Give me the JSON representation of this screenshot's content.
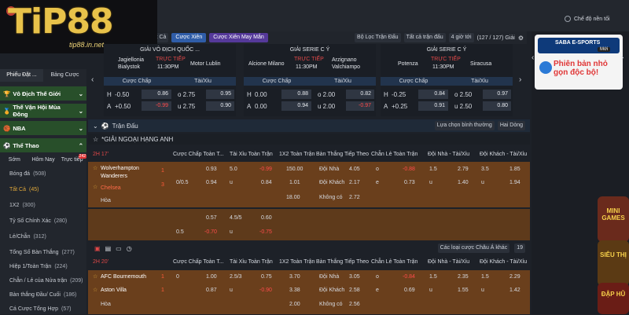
{
  "brand": {
    "logo": "TiP88",
    "url": "tip88.in.net"
  },
  "top": {
    "dark_mode_label": "Chế độ nền tối"
  },
  "toolbar": {
    "prefix": "ay",
    "sort": "Tất Cả",
    "tab_xien": "Cược Xiên",
    "tab_may_man": "Cược Xiên May Mắn",
    "filter_league": "Bộ Lọc Trận Đấu",
    "filter_all": "Tất cả trận đấu",
    "time": "4 giờ tới",
    "count": "(127 / 127) Giải"
  },
  "cards": [
    {
      "league": "GIẢI VÔ ĐỊCH QUỐC ...",
      "home": "Jagiellonia Bialystok",
      "status": "TRỰC TIẾP",
      "time": "11:30PM",
      "away": "Motor Lublin",
      "h_hcap": "-0.50",
      "h_odds": "0.86",
      "h_ou": "o 2.75",
      "h_ou_odds": "0.95",
      "a_hcap": "+0.50",
      "a_odds": "-0.99",
      "a_ou": "u 2.75",
      "a_ou_odds": "0.90"
    },
    {
      "league": "GIẢI SERIE C Ý",
      "home": "Alcione Milano",
      "status": "TRỰC TIẾP",
      "time": "11:30PM",
      "away": "Arzignano Valchiampo",
      "h_hcap": "0.00",
      "h_odds": "0.88",
      "h_ou": "o 2.00",
      "h_ou_odds": "0.82",
      "a_hcap": "0.00",
      "a_odds": "0.94",
      "a_ou": "u 2.00",
      "a_ou_odds": "-0.97"
    },
    {
      "league": "GIẢI SERIE C Ý",
      "home": "Potenza",
      "status": "TRỰC TIẾP",
      "time": "11:30PM",
      "away": "Siracusa",
      "h_hcap": "-0.25",
      "h_odds": "0.84",
      "h_ou": "o 2.50",
      "h_ou_odds": "0.97",
      "a_hcap": "+0.25",
      "a_odds": "0.91",
      "a_ou": "u 2.50",
      "a_ou_odds": "0.80"
    }
  ],
  "card_labels": {
    "hcap": "Cược Chấp",
    "ou": "Tài/Xỉu",
    "h": "H",
    "a": "A"
  },
  "sidebar": {
    "tabs": [
      "Phiếu Đặt ...",
      "Bảng Cược"
    ],
    "cats": [
      "Vô Địch Thế Giới",
      "Thế Vận Hội Mùa Đông",
      "NBA",
      "Thể Thao"
    ],
    "sub_tabs": [
      "Sớm",
      "Hôm Nay",
      "Trực tiếp"
    ],
    "live_badge": "242",
    "items": [
      {
        "label": "Bóng đá",
        "count": "(508)"
      },
      {
        "label": "Tất Cả",
        "count": "(45)"
      },
      {
        "label": "1X2",
        "count": "(300)"
      },
      {
        "label": "Tỷ Số Chính Xác",
        "count": "(280)"
      },
      {
        "label": "Lẻ/Chẵn",
        "count": "(312)"
      },
      {
        "label": "Tổng Số Bàn Thắng",
        "count": "(277)"
      },
      {
        "label": "Hiệp 1/Toàn Trận",
        "count": "(224)"
      },
      {
        "label": "Chẵn / Lẻ của Nửa trận",
        "count": "(209)"
      },
      {
        "label": "Bàn thắng Đầu/ Cuối",
        "count": "(186)"
      },
      {
        "label": "Cá Cược Tổng Hợp",
        "count": "(57)"
      }
    ]
  },
  "section": {
    "title": "Trận Đấu",
    "select_label": "Lựa chọn bình thường",
    "select_order": "Hai Dòng",
    "league": "*GIẢI NGOẠI HẠNG ANH",
    "asia_label": "Các loại cược Châu Á khác",
    "page_num": "19"
  },
  "cols": [
    "Cược Chấp Toàn T...",
    "Tài Xỉu Toàn Trận",
    "1X2 Toàn Trận",
    "Bàn Thắng Tiếp Theo",
    "Chẵn Lẻ Toàn Trận",
    "Đội Nhà - Tài/Xỉu",
    "Đội Khách - Tài/Xỉu"
  ],
  "match1": {
    "period": "2H 17'",
    "home": "Wolverhampton Wanderers",
    "away": "Chelsea",
    "draw": "Hòa",
    "home_score": "1",
    "away_score": "3",
    "r1": [
      "",
      "0.93",
      "5.0",
      "-0.99",
      "150.00",
      "Đội Nhà",
      "4.05",
      "o",
      "-0.88",
      "1.5",
      "2.79",
      "3.5",
      "1.85"
    ],
    "r2": [
      "0/0.5",
      "0.94",
      "u",
      "0.84",
      "1.01",
      "Đội Khách",
      "2.17",
      "e",
      "0.73",
      "u",
      "1.40",
      "u",
      "1.94"
    ],
    "r3": [
      "",
      "",
      "",
      "",
      "18.00",
      "Không có",
      "2.72"
    ],
    "r4": [
      "",
      "0.57",
      "4.5/5",
      "0.60"
    ],
    "r5": [
      "0.5",
      "-0.70",
      "u",
      "-0.75"
    ]
  },
  "match2": {
    "period": "2H 20'",
    "home": "AFC Bournemouth",
    "away": "Aston Villa",
    "draw": "Hòa",
    "home_score": "1",
    "away_score": "1",
    "r1": [
      "0",
      "1.00",
      "2.5/3",
      "0.75",
      "3.70",
      "Đội Nhà",
      "3.05",
      "o",
      "-0.84",
      "1.5",
      "2.35",
      "1.5",
      "2.29"
    ],
    "r2": [
      "",
      "0.87",
      "u",
      "-0.90",
      "3.38",
      "Đội Khách",
      "2.58",
      "e",
      "0.69",
      "u",
      "1.55",
      "u",
      "1.42"
    ],
    "r3": [
      "",
      "",
      "",
      "",
      "2.00",
      "Không có",
      "2.56"
    ]
  },
  "side": {
    "banner_title": "SABA E-SPORTS",
    "banner_badge": "Mới",
    "banner_cta": "Phiên bản nhỏ gọn độc bộ!",
    "games": [
      "MINI GAMES",
      "SIÊU THỊ",
      "ĐẬP HŨ"
    ]
  },
  "colors": {
    "accent": "#2f5da8",
    "live": "#e04848",
    "match_bg": "#6a3f1c",
    "green_cat": "#284f2a"
  }
}
